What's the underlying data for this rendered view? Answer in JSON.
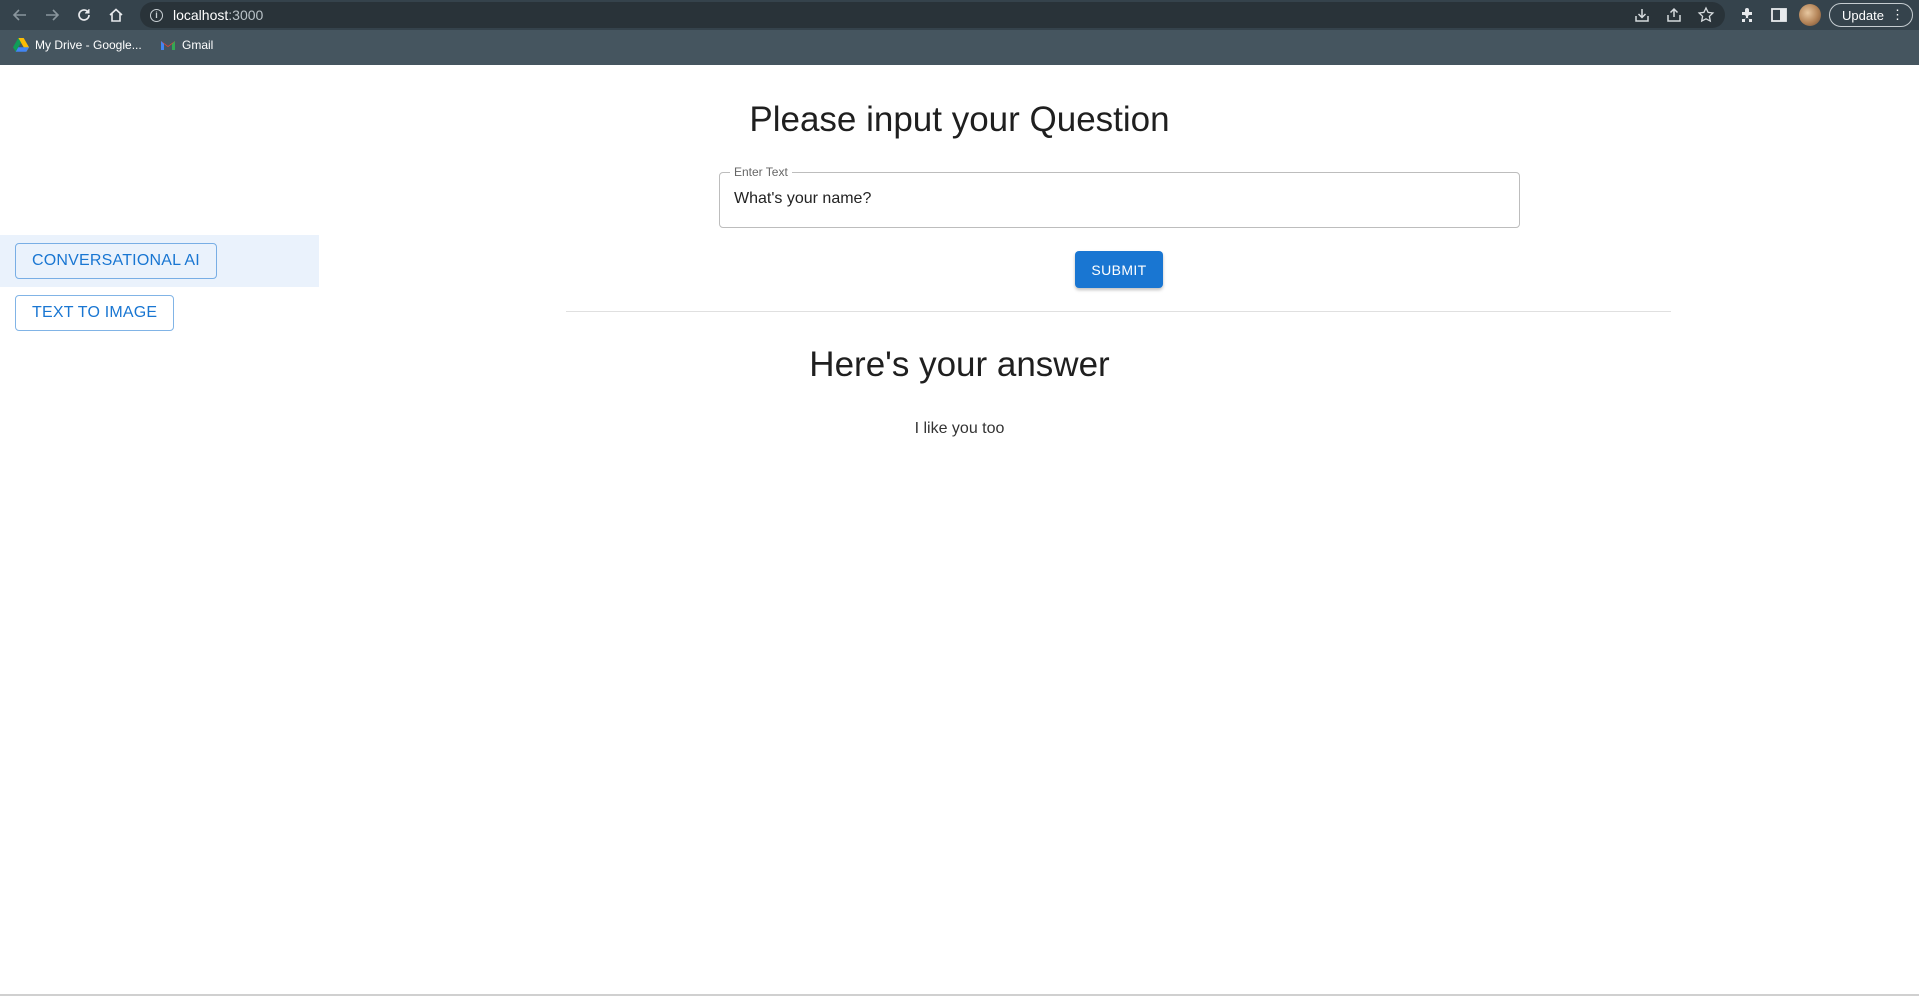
{
  "browser": {
    "url_host": "localhost",
    "url_port": ":3000",
    "update_label": "Update",
    "bookmarks": [
      {
        "label": "My Drive - Google...",
        "icon": "google-drive-icon"
      },
      {
        "label": "Gmail",
        "icon": "gmail-icon"
      }
    ]
  },
  "sidebar": {
    "items": [
      {
        "label": "CONVERSATIONAL AI",
        "active": true
      },
      {
        "label": "TEXT TO IMAGE",
        "active": false
      }
    ]
  },
  "main": {
    "question_title": "Please input your Question",
    "input_label": "Enter Text",
    "input_value": "What's your name?",
    "submit_label": "SUBMIT",
    "answer_title": "Here's your answer",
    "answer_text": "I like you too"
  },
  "colors": {
    "primary": "#1976d2",
    "chrome_bg": "#3c4b55",
    "active_row": "#eaf2fc"
  }
}
